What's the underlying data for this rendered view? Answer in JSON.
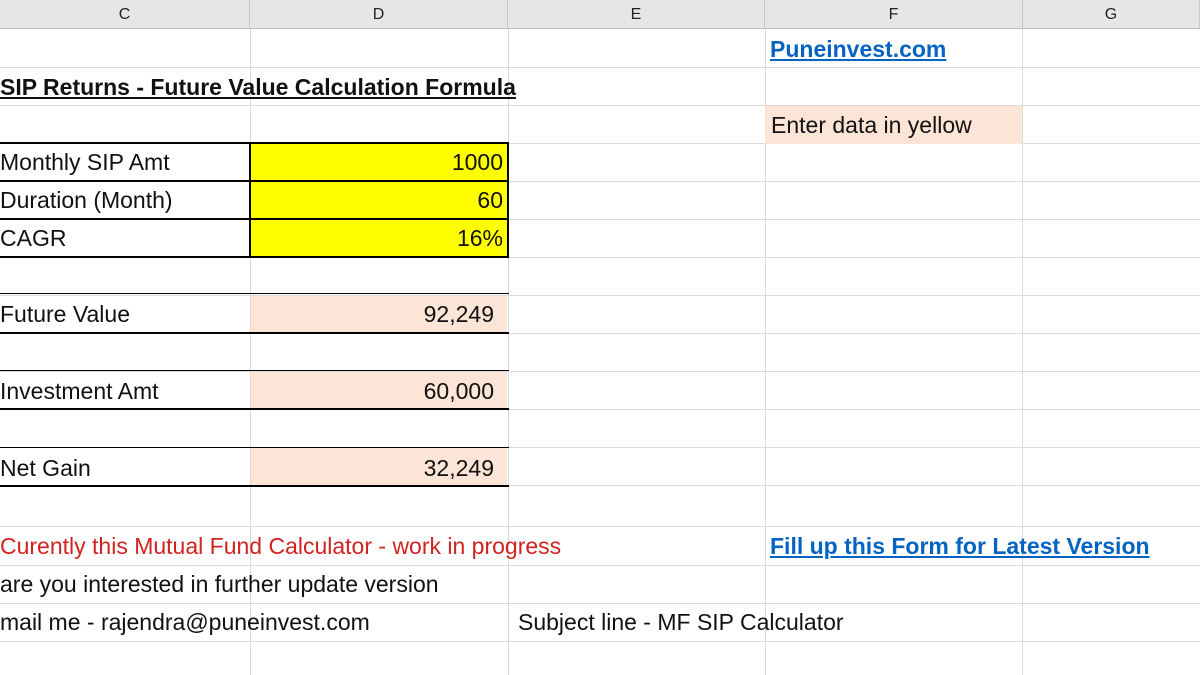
{
  "columns": [
    "C",
    "D",
    "E",
    "F",
    "G"
  ],
  "link_top": "Puneinvest.com",
  "title": "SIP Returns - Future Value Calculation Formula",
  "note": "Enter data in yellow",
  "inputs": [
    {
      "label": "Monthly SIP Amt",
      "value": "1000"
    },
    {
      "label": "Duration (Month)",
      "value": "60"
    },
    {
      "label": "CAGR",
      "value": "16%"
    }
  ],
  "outputs": [
    {
      "label": "Future Value",
      "value": "92,249"
    },
    {
      "label": "Investment Amt",
      "value": "60,000"
    },
    {
      "label": "Net Gain",
      "value": "32,249"
    }
  ],
  "footer": {
    "progress": "Curently this Mutual Fund Calculator - work in progress",
    "form_link": "Fill up this Form for Latest Version",
    "interest": "are you interested in further update version",
    "mail": "mail me - rajendra@puneinvest.com",
    "subject": "Subject line - MF SIP Calculator"
  },
  "colors": {
    "yellow": "#ffff00",
    "peach": "#fce4d6",
    "link": "#0563c1",
    "red": "#d0231f"
  }
}
